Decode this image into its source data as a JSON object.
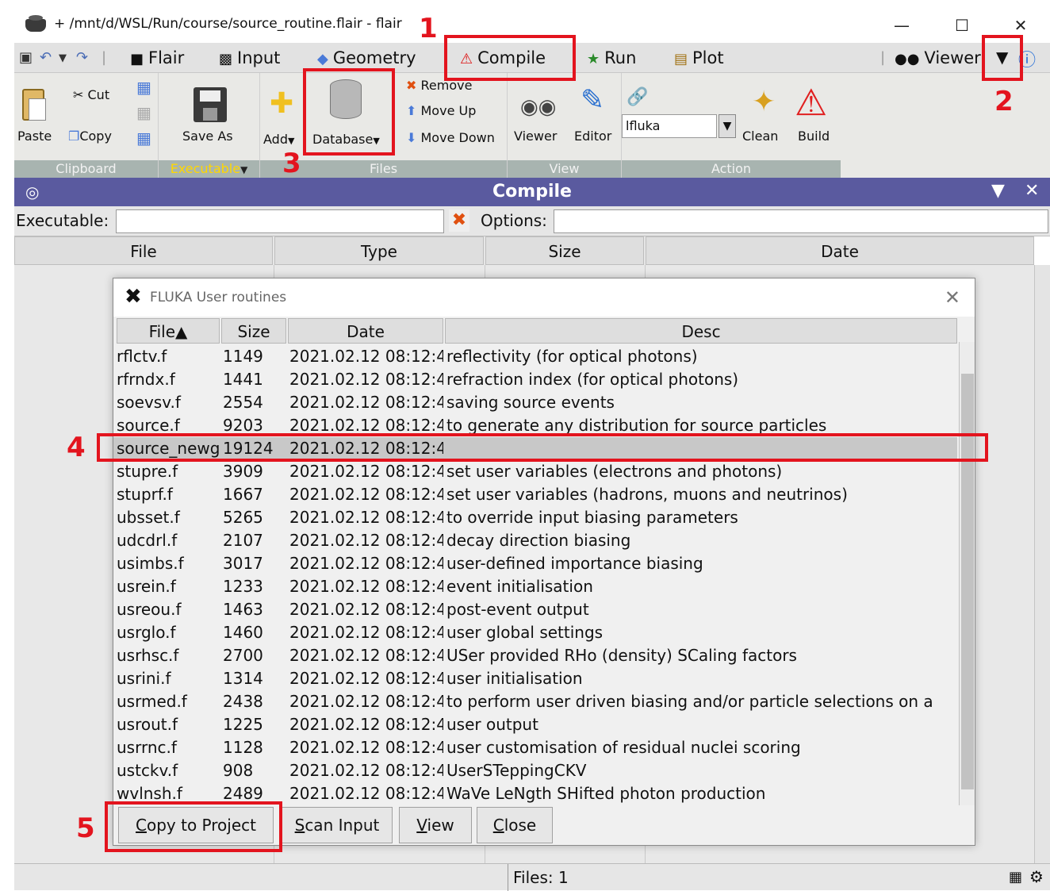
{
  "window": {
    "title": "+ /mnt/d/WSL/Run/course/source_routine.flair - flair",
    "minimize": "—",
    "maximize": "☐",
    "close": "✕"
  },
  "menubar": {
    "items": [
      {
        "label": "Flair",
        "icon": "flair-icon"
      },
      {
        "label": "Input",
        "icon": "input-icon"
      },
      {
        "label": "Geometry",
        "icon": "geometry-icon"
      },
      {
        "label": "Compile",
        "icon": "compile-icon"
      },
      {
        "label": "Run",
        "icon": "run-icon"
      },
      {
        "label": "Plot",
        "icon": "plot-icon"
      },
      {
        "label": "Viewer",
        "icon": "viewer-icon"
      }
    ]
  },
  "ribbon": {
    "clipboard": {
      "cut": "Cut",
      "paste": "Paste",
      "copy": "Copy",
      "label": "Clipboard"
    },
    "executable": {
      "save_as": "Save As",
      "label": "Executable"
    },
    "files": {
      "add": "Add",
      "database": "Database",
      "remove": "Remove",
      "move_up": "Move Up",
      "move_down": "Move Down",
      "label": "Files"
    },
    "view": {
      "viewer": "Viewer",
      "editor": "Editor",
      "label": "View"
    },
    "action": {
      "compiler": "lfluka",
      "clean": "Clean",
      "build": "Build",
      "label": "Action"
    }
  },
  "compile_panel": {
    "title": "Compile",
    "executable_label": "Executable:",
    "executable_value": "",
    "options_label": "Options:",
    "options_value": ""
  },
  "main_table": {
    "columns": [
      "File",
      "Type",
      "Size",
      "Date"
    ]
  },
  "status": {
    "files": "Files: 1"
  },
  "dialog": {
    "title": "FLUKA User routines",
    "columns": [
      "File▲",
      "Size",
      "Date",
      "Desc"
    ],
    "rows": [
      {
        "file": "rflctv.f",
        "size": "1149",
        "date": "2021.02.12 08:12:4",
        "desc": "reflectivity (for optical photons)"
      },
      {
        "file": "rfrndx.f",
        "size": "1441",
        "date": "2021.02.12 08:12:4",
        "desc": "refraction index (for optical photons)"
      },
      {
        "file": "soevsv.f",
        "size": "2554",
        "date": "2021.02.12 08:12:4",
        "desc": "saving source events"
      },
      {
        "file": "source.f",
        "size": "9203",
        "date": "2021.02.12 08:12:4",
        "desc": "to generate any distribution for source particles"
      },
      {
        "file": "source_newg",
        "size": "19124",
        "date": "2021.02.12 08:12:4",
        "desc": ""
      },
      {
        "file": "stupre.f",
        "size": "3909",
        "date": "2021.02.12 08:12:4",
        "desc": "set user variables (electrons and photons)"
      },
      {
        "file": "stuprf.f",
        "size": "1667",
        "date": "2021.02.12 08:12:4",
        "desc": "set user variables (hadrons, muons and neutrinos)"
      },
      {
        "file": "ubsset.f",
        "size": "5265",
        "date": "2021.02.12 08:12:4",
        "desc": "to override input biasing parameters"
      },
      {
        "file": "udcdrl.f",
        "size": "2107",
        "date": "2021.02.12 08:12:4",
        "desc": "decay direction biasing"
      },
      {
        "file": "usimbs.f",
        "size": "3017",
        "date": "2021.02.12 08:12:4",
        "desc": "user-defined importance biasing"
      },
      {
        "file": "usrein.f",
        "size": "1233",
        "date": "2021.02.12 08:12:4",
        "desc": "event initialisation"
      },
      {
        "file": "usreou.f",
        "size": "1463",
        "date": "2021.02.12 08:12:4",
        "desc": "post-event output"
      },
      {
        "file": "usrglo.f",
        "size": "1460",
        "date": "2021.02.12 08:12:4",
        "desc": "user global settings"
      },
      {
        "file": "usrhsc.f",
        "size": "2700",
        "date": "2021.02.12 08:12:4",
        "desc": "USer provided RHo (density) SCaling factors"
      },
      {
        "file": "usrini.f",
        "size": "1314",
        "date": "2021.02.12 08:12:4",
        "desc": "user initialisation"
      },
      {
        "file": "usrmed.f",
        "size": "2438",
        "date": "2021.02.12 08:12:4",
        "desc": "to perform user driven biasing and/or particle selections on a"
      },
      {
        "file": "usrout.f",
        "size": "1225",
        "date": "2021.02.12 08:12:4",
        "desc": "user output"
      },
      {
        "file": "usrrnc.f",
        "size": "1128",
        "date": "2021.02.12 08:12:4",
        "desc": "user customisation of residual nuclei scoring"
      },
      {
        "file": "ustckv.f",
        "size": "908",
        "date": "2021.02.12 08:12:4",
        "desc": "UserSTeppingCKV"
      },
      {
        "file": "wvlnsh.f",
        "size": "2489",
        "date": "2021.02.12 08:12:4",
        "desc": "WaVe LeNgth SHifted photon production"
      }
    ],
    "selected_index": 4,
    "buttons": {
      "copy": {
        "mnemonic": "C",
        "rest": "opy to Project"
      },
      "scan": {
        "mnemonic": "S",
        "rest": "can Input"
      },
      "view": {
        "mnemonic": "V",
        "rest": "iew"
      },
      "close": {
        "mnemonic": "C",
        "rest": "lose"
      }
    }
  },
  "annotations": [
    "1",
    "2",
    "3",
    "4",
    "5"
  ],
  "colors": {
    "annotation": "#e3141e",
    "header": "#5a5a9f",
    "ribbon_group_label": "#a8b4b0",
    "executable_label": "#ffd700"
  }
}
